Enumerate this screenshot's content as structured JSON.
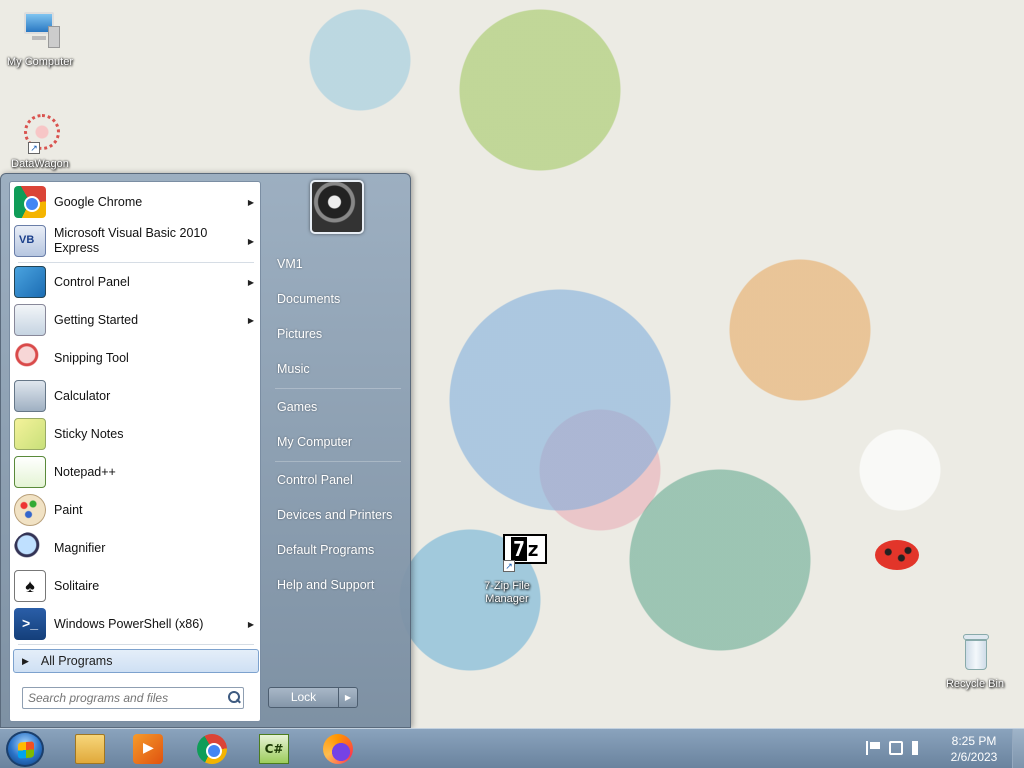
{
  "desktop": {
    "icons": [
      {
        "label": "My Computer",
        "icon": "computer-icon"
      },
      {
        "label": "DataWagon",
        "icon": "datawagon-icon"
      },
      {
        "label": "7-Zip File Manager",
        "icon": "7zip-icon"
      },
      {
        "label": "Recycle Bin",
        "icon": "recycle-bin-icon"
      }
    ]
  },
  "start_menu": {
    "programs": [
      {
        "label": "Google Chrome",
        "has_submenu": true
      },
      {
        "label": "Microsoft Visual Basic 2010 Express",
        "has_submenu": true
      },
      {
        "label": "Control Panel",
        "has_submenu": true
      },
      {
        "label": "Getting Started",
        "has_submenu": true
      },
      {
        "label": "Snipping Tool",
        "has_submenu": false
      },
      {
        "label": "Calculator",
        "has_submenu": false
      },
      {
        "label": "Sticky Notes",
        "has_submenu": false
      },
      {
        "label": "Notepad++",
        "has_submenu": false
      },
      {
        "label": "Paint",
        "has_submenu": false
      },
      {
        "label": "Magnifier",
        "has_submenu": false
      },
      {
        "label": "Solitaire",
        "has_submenu": false
      },
      {
        "label": "Windows PowerShell (x86)",
        "has_submenu": true
      }
    ],
    "all_programs": "All Programs",
    "search_placeholder": "Search programs and files",
    "right_links": [
      "VM1",
      "Documents",
      "Pictures",
      "Music",
      "Games",
      "My Computer",
      "Control Panel",
      "Devices and Printers",
      "Default Programs",
      "Help and Support"
    ],
    "lock_label": "Lock"
  },
  "taskbar": {
    "pinned": [
      "windows-explorer-icon",
      "media-player-icon",
      "chrome-icon",
      "csharp-icon",
      "firefox-icon"
    ],
    "clock_time": "8:25 PM",
    "clock_date": "2/6/2023"
  }
}
